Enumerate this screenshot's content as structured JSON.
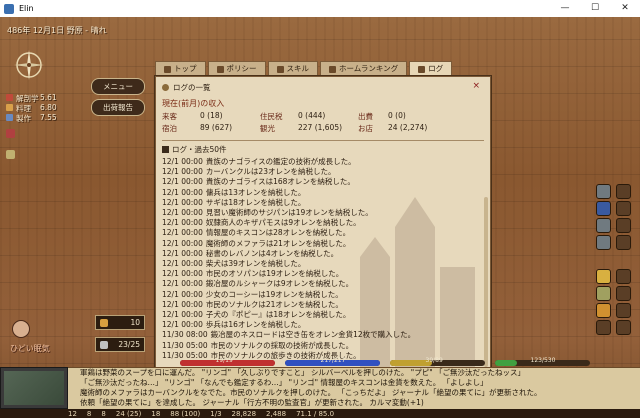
{
  "window": {
    "title": "Elin",
    "minimize": "—",
    "maximize": "☐",
    "close": "✕"
  },
  "hud": {
    "date": "486年 12月1日 野原 - 晴れ",
    "stats": [
      {
        "label": "解剖学",
        "value": "5.61",
        "color": "#c04a3a"
      },
      {
        "label": "料理",
        "value": "6.80",
        "color": "#d9a04a"
      },
      {
        "label": "製作",
        "value": "7.55",
        "color": "#6a8ac0"
      }
    ],
    "menu_label": "メニュー",
    "report_label": "出荷報告",
    "counter1": "10",
    "counter2": "23/25",
    "hunger": "ひどい眠気"
  },
  "tabs": [
    {
      "label": "トップ",
      "active": false
    },
    {
      "label": "ポリシー",
      "active": false
    },
    {
      "label": "スキル",
      "active": false
    },
    {
      "label": "ホームランキング",
      "active": false
    },
    {
      "label": "ログ",
      "active": true
    }
  ],
  "panel": {
    "title": "ログの一覧",
    "close": "×",
    "income_title": "現在(前月)の収入",
    "income": [
      {
        "k": "来客",
        "v": "0 (18)"
      },
      {
        "k": "住民税",
        "v": "0 (444)"
      },
      {
        "k": "出費",
        "v": "0 (0)"
      },
      {
        "k": "宿泊",
        "v": "89 (627)"
      },
      {
        "k": "観光",
        "v": "227 (1,605)"
      },
      {
        "k": "お店",
        "v": "24 (2,274)"
      }
    ],
    "log_heading": "ログ・過去50件",
    "log": [
      {
        "t": "12/1 00:00",
        "m": "貴族のナゴライスの鑑定の技術が成長した。"
      },
      {
        "t": "12/1 00:00",
        "m": "カーバンクルは23オレンを納税した。"
      },
      {
        "t": "12/1 00:00",
        "m": "貴族のナゴライスは168オレンを納税した。"
      },
      {
        "t": "12/1 00:00",
        "m": "傭兵は13オレンを納税した。"
      },
      {
        "t": "12/1 00:00",
        "m": "サギは18オレンを納税した。"
      },
      {
        "t": "12/1 00:00",
        "m": "見習い魔術師のサジパンは19オレンを納税した。"
      },
      {
        "t": "12/1 00:00",
        "m": "奴隷商人のキザパモスは9オレンを納税した。"
      },
      {
        "t": "12/1 00:00",
        "m": "情報屋のキスコンは28オレンを納税した。"
      },
      {
        "t": "12/1 00:00",
        "m": "魔術師のメファラは21オレンを納税した。"
      },
      {
        "t": "12/1 00:00",
        "m": "秘書のレバノンは4オレンを納税した。"
      },
      {
        "t": "12/1 00:00",
        "m": "柴犬は39オレンを納税した。"
      },
      {
        "t": "12/1 00:00",
        "m": "市民のオソパンは19オレンを納税した。"
      },
      {
        "t": "12/1 00:00",
        "m": "鍛冶屋のルシャークは9オレンを納税した。"
      },
      {
        "t": "12/1 00:00",
        "m": "少女のコーシーは19オレンを納税した。"
      },
      {
        "t": "12/1 00:00",
        "m": "市民のソナルクは21オレンを納税した。"
      },
      {
        "t": "12/1 00:00",
        "m": "子犬の『ポピー』は18オレンを納税した。"
      },
      {
        "t": "12/1 00:00",
        "m": "歩兵は16オレンを納税した。"
      },
      {
        "t": "11/30 08:00",
        "m": "鍛冶屋のネスロードは空き缶をオレン金貨12枚で購入した。"
      },
      {
        "t": "11/30 05:00",
        "m": "市民のソナルクの採取の技術が成長した。"
      },
      {
        "t": "11/30 05:00",
        "m": "市民のソナルクの旅歩きの技術が成長した。"
      }
    ]
  },
  "gauges": [
    {
      "label": "19/19",
      "color": "#c03030",
      "fill": 1.0
    },
    {
      "label": "217/217",
      "color": "#3050c0",
      "fill": 1.0
    },
    {
      "label": "39/89",
      "color": "#c0a030",
      "fill": 0.44
    },
    {
      "label": "123/530",
      "color": "#40a040",
      "fill": 0.23
    }
  ],
  "messages": [
    "軍鶏は野菜のスープを口に運んだ。 \"リンゴ\" 「久しぶりですこと」 シルバーベルを押しのけた。 \"プピ\" 「ご無沙汰だったねッス」",
    "「ご無沙汰だったね…」 \"リンゴ\" 「なんでも鑑定するわ…」 \"リンゴ\" 情報屋のキスコンは金貨を数えた。 「よしよし」",
    "魔術師のメファラはカーバンクルをなでた。市民のソナルクを押しのけた。 「こっちだよ」 ジャーナル「絶望の果てに」が更新された。",
    "依頼「絶望の果てに」を達成した。 ジャーナル「行方不明の監査官」が更新された。 カルマ変動(+1)"
  ],
  "status": [
    "12",
    "8",
    "8",
    "24 (25)",
    "18",
    "88 (100)",
    "1/3",
    "28,828",
    "2,488",
    "71.1 / 85.0"
  ]
}
